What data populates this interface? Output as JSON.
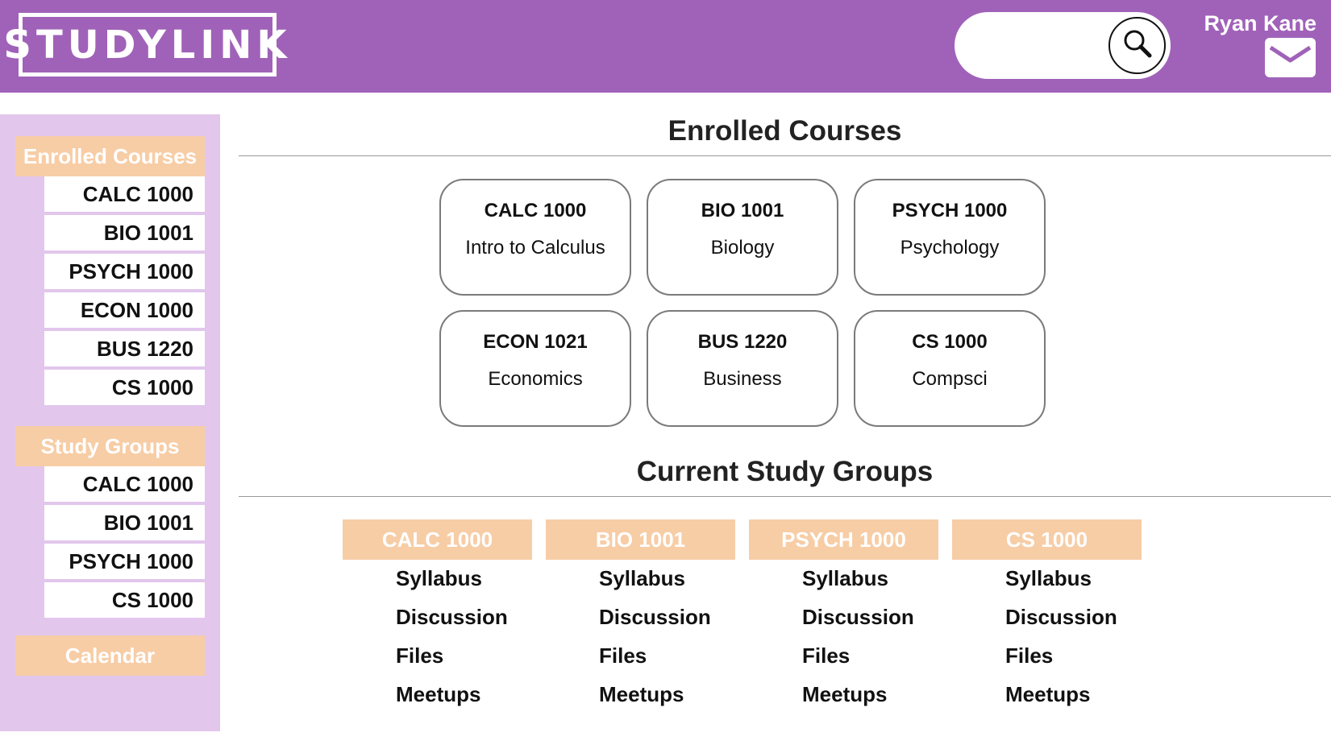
{
  "header": {
    "logo": "STUDYLINK",
    "username": "Ryan Kane",
    "search": {
      "placeholder": ""
    },
    "icons": {
      "search": "search-icon",
      "mail": "mail-icon"
    }
  },
  "sidebar": {
    "enrolled_heading": "Enrolled Courses",
    "enrolled_items": [
      "CALC 1000",
      "BIO 1001",
      "PSYCH 1000",
      "ECON 1000",
      "BUS 1220",
      "CS 1000"
    ],
    "groups_heading": "Study Groups",
    "group_items": [
      "CALC 1000",
      "BIO 1001",
      "PSYCH 1000",
      "CS 1000"
    ],
    "calendar": "Calendar"
  },
  "main": {
    "enrolled_title": "Enrolled Courses",
    "courses": [
      {
        "code": "CALC 1000",
        "name": "Intro to Calculus"
      },
      {
        "code": "BIO 1001",
        "name": "Biology"
      },
      {
        "code": "PSYCH 1000",
        "name": "Psychology"
      },
      {
        "code": "ECON 1021",
        "name": "Economics"
      },
      {
        "code": "BUS 1220",
        "name": "Business"
      },
      {
        "code": "CS 1000",
        "name": "Compsci"
      }
    ],
    "groups_title": "Current Study Groups",
    "groups": [
      {
        "name": "CALC 1000",
        "links": [
          "Syllabus",
          "Discussion",
          "Files",
          "Meetups"
        ]
      },
      {
        "name": "BIO 1001",
        "links": [
          "Syllabus",
          "Discussion",
          "Files",
          "Meetups"
        ]
      },
      {
        "name": "PSYCH 1000",
        "links": [
          "Syllabus",
          "Discussion",
          "Files",
          "Meetups"
        ]
      },
      {
        "name": "CS 1000",
        "links": [
          "Syllabus",
          "Discussion",
          "Files",
          "Meetups"
        ]
      }
    ]
  },
  "colors": {
    "header_bg": "#a062b8",
    "sidebar_bg": "#e2c6ec",
    "accent_peach": "#f7cda6"
  }
}
